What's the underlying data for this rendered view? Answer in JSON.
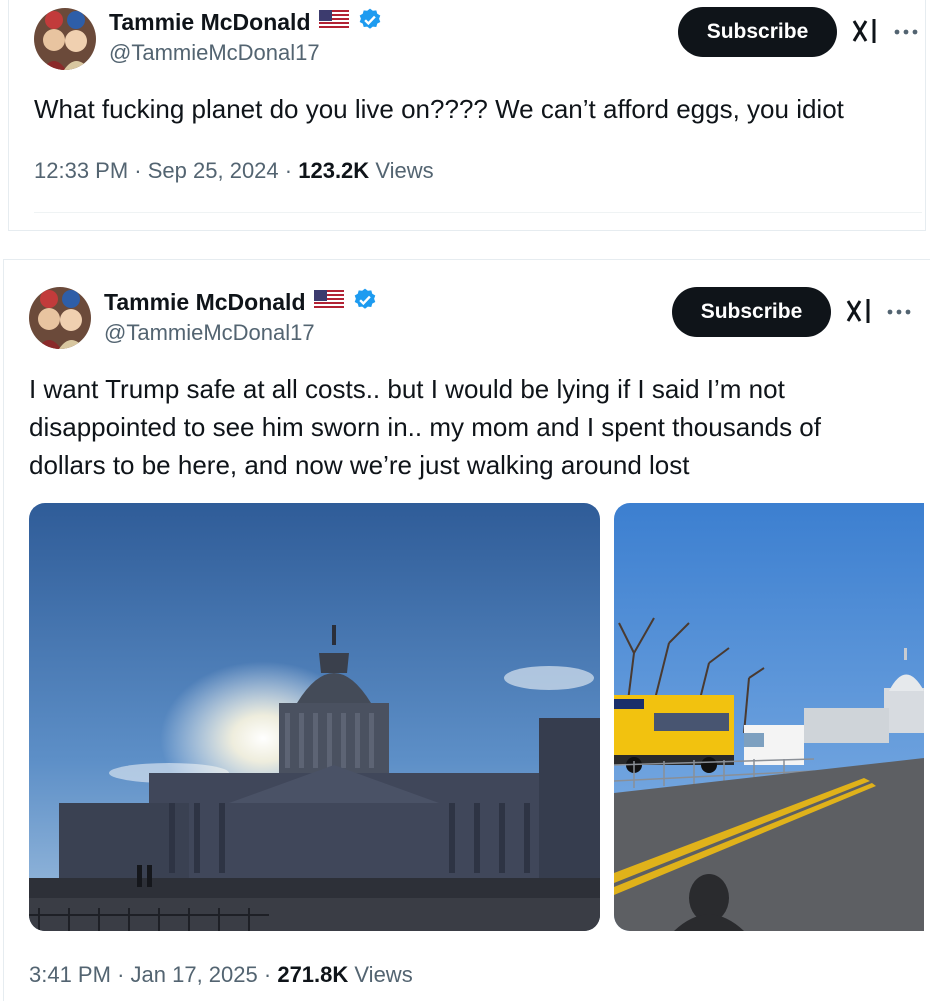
{
  "tweets": [
    {
      "author_name": "Tammie McDonald",
      "handle": "@TammieMcDonal17",
      "subscribe_label": "Subscribe",
      "text": "What fucking planet do you live on???? We can’t afford eggs, you idiot",
      "time": "12:33 PM",
      "date": "Sep 25, 2024",
      "views_count": "123.2K",
      "views_label": "Views"
    },
    {
      "author_name": "Tammie McDonald",
      "handle": "@TammieMcDonal17",
      "subscribe_label": "Subscribe",
      "text": "I want Trump safe at all costs.. but I would be lying if I said I’m not disappointed to see him sworn in.. my mom and I spent thousands of dollars to be here, and now we’re just walking around lost",
      "time": "3:41 PM",
      "date": "Jan 17, 2025",
      "views_count": "271.8K",
      "views_label": "Views"
    }
  ],
  "separator": "·",
  "icons": {
    "flag": "us-flag-icon",
    "verified": "verified-badge-icon",
    "grok": "grok-icon",
    "more": "more-icon"
  },
  "colors": {
    "verified": "#1d9bf0",
    "subscribe_bg": "#0f1419",
    "secondary_text": "#536471"
  }
}
